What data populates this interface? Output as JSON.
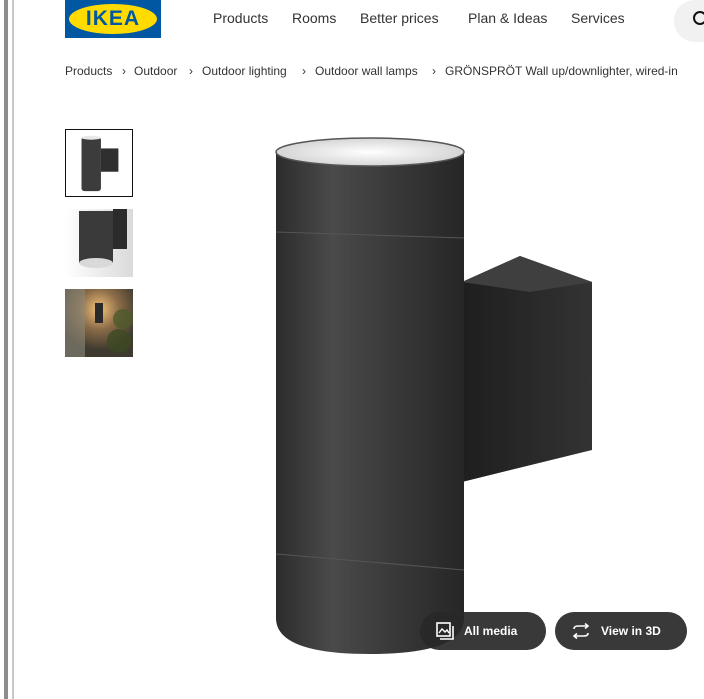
{
  "header": {
    "logo_text": "IKEA",
    "brand_colors": {
      "blue": "#0058a3",
      "yellow": "#ffdb00"
    },
    "nav": [
      "Products",
      "Rooms",
      "Better prices",
      "Plan & Ideas",
      "Services"
    ],
    "search_icon": "search-icon"
  },
  "breadcrumb": [
    "Products",
    "Outdoor",
    "Outdoor lighting",
    "Outdoor wall lamps",
    "GRÖNSPRÖT Wall up/downlighter, wired-in"
  ],
  "gallery": {
    "thumbnails": [
      "product-front",
      "product-bottom",
      "product-in-use"
    ],
    "selected_index": 0
  },
  "media_buttons": {
    "all_media": "All media",
    "view_3d": "View in 3D"
  }
}
